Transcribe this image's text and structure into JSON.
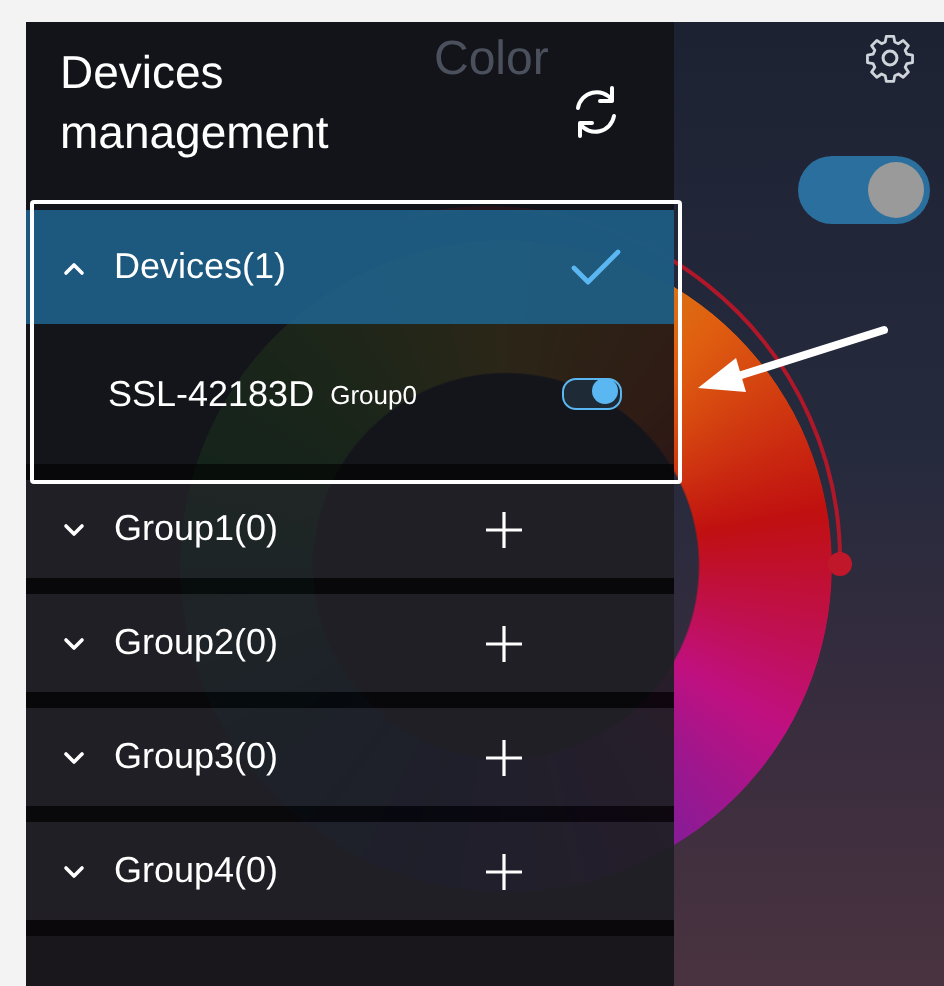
{
  "background": {
    "title": "Color",
    "power_switch": {
      "on": true
    }
  },
  "drawer": {
    "title": "Devices management"
  },
  "groups": [
    {
      "name": "Devices(1)",
      "expanded": true,
      "selected": true,
      "devices": [
        {
          "name": "SSL-42183D",
          "group": "Group0",
          "on": true
        }
      ]
    },
    {
      "name": "Group1(0)",
      "expanded": false,
      "selected": false
    },
    {
      "name": "Group2(0)",
      "expanded": false,
      "selected": false
    },
    {
      "name": "Group3(0)",
      "expanded": false,
      "selected": false
    },
    {
      "name": "Group4(0)",
      "expanded": false,
      "selected": false
    }
  ]
}
